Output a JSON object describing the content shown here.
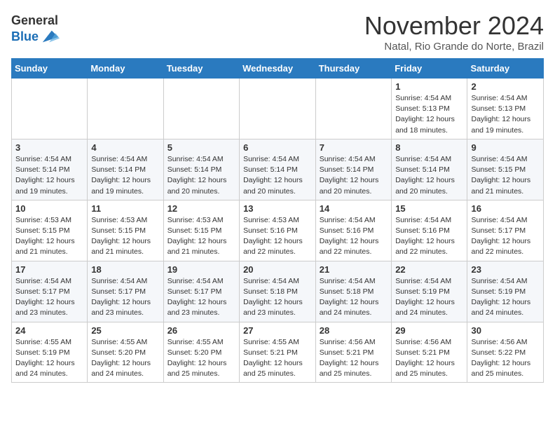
{
  "logo": {
    "general": "General",
    "blue": "Blue"
  },
  "header": {
    "month": "November 2024",
    "location": "Natal, Rio Grande do Norte, Brazil"
  },
  "weekdays": [
    "Sunday",
    "Monday",
    "Tuesday",
    "Wednesday",
    "Thursday",
    "Friday",
    "Saturday"
  ],
  "weeks": [
    [
      {
        "day": "",
        "info": ""
      },
      {
        "day": "",
        "info": ""
      },
      {
        "day": "",
        "info": ""
      },
      {
        "day": "",
        "info": ""
      },
      {
        "day": "",
        "info": ""
      },
      {
        "day": "1",
        "info": "Sunrise: 4:54 AM\nSunset: 5:13 PM\nDaylight: 12 hours\nand 18 minutes."
      },
      {
        "day": "2",
        "info": "Sunrise: 4:54 AM\nSunset: 5:13 PM\nDaylight: 12 hours\nand 19 minutes."
      }
    ],
    [
      {
        "day": "3",
        "info": "Sunrise: 4:54 AM\nSunset: 5:14 PM\nDaylight: 12 hours\nand 19 minutes."
      },
      {
        "day": "4",
        "info": "Sunrise: 4:54 AM\nSunset: 5:14 PM\nDaylight: 12 hours\nand 19 minutes."
      },
      {
        "day": "5",
        "info": "Sunrise: 4:54 AM\nSunset: 5:14 PM\nDaylight: 12 hours\nand 20 minutes."
      },
      {
        "day": "6",
        "info": "Sunrise: 4:54 AM\nSunset: 5:14 PM\nDaylight: 12 hours\nand 20 minutes."
      },
      {
        "day": "7",
        "info": "Sunrise: 4:54 AM\nSunset: 5:14 PM\nDaylight: 12 hours\nand 20 minutes."
      },
      {
        "day": "8",
        "info": "Sunrise: 4:54 AM\nSunset: 5:14 PM\nDaylight: 12 hours\nand 20 minutes."
      },
      {
        "day": "9",
        "info": "Sunrise: 4:54 AM\nSunset: 5:15 PM\nDaylight: 12 hours\nand 21 minutes."
      }
    ],
    [
      {
        "day": "10",
        "info": "Sunrise: 4:53 AM\nSunset: 5:15 PM\nDaylight: 12 hours\nand 21 minutes."
      },
      {
        "day": "11",
        "info": "Sunrise: 4:53 AM\nSunset: 5:15 PM\nDaylight: 12 hours\nand 21 minutes."
      },
      {
        "day": "12",
        "info": "Sunrise: 4:53 AM\nSunset: 5:15 PM\nDaylight: 12 hours\nand 21 minutes."
      },
      {
        "day": "13",
        "info": "Sunrise: 4:53 AM\nSunset: 5:16 PM\nDaylight: 12 hours\nand 22 minutes."
      },
      {
        "day": "14",
        "info": "Sunrise: 4:54 AM\nSunset: 5:16 PM\nDaylight: 12 hours\nand 22 minutes."
      },
      {
        "day": "15",
        "info": "Sunrise: 4:54 AM\nSunset: 5:16 PM\nDaylight: 12 hours\nand 22 minutes."
      },
      {
        "day": "16",
        "info": "Sunrise: 4:54 AM\nSunset: 5:17 PM\nDaylight: 12 hours\nand 22 minutes."
      }
    ],
    [
      {
        "day": "17",
        "info": "Sunrise: 4:54 AM\nSunset: 5:17 PM\nDaylight: 12 hours\nand 23 minutes."
      },
      {
        "day": "18",
        "info": "Sunrise: 4:54 AM\nSunset: 5:17 PM\nDaylight: 12 hours\nand 23 minutes."
      },
      {
        "day": "19",
        "info": "Sunrise: 4:54 AM\nSunset: 5:17 PM\nDaylight: 12 hours\nand 23 minutes."
      },
      {
        "day": "20",
        "info": "Sunrise: 4:54 AM\nSunset: 5:18 PM\nDaylight: 12 hours\nand 23 minutes."
      },
      {
        "day": "21",
        "info": "Sunrise: 4:54 AM\nSunset: 5:18 PM\nDaylight: 12 hours\nand 24 minutes."
      },
      {
        "day": "22",
        "info": "Sunrise: 4:54 AM\nSunset: 5:19 PM\nDaylight: 12 hours\nand 24 minutes."
      },
      {
        "day": "23",
        "info": "Sunrise: 4:54 AM\nSunset: 5:19 PM\nDaylight: 12 hours\nand 24 minutes."
      }
    ],
    [
      {
        "day": "24",
        "info": "Sunrise: 4:55 AM\nSunset: 5:19 PM\nDaylight: 12 hours\nand 24 minutes."
      },
      {
        "day": "25",
        "info": "Sunrise: 4:55 AM\nSunset: 5:20 PM\nDaylight: 12 hours\nand 24 minutes."
      },
      {
        "day": "26",
        "info": "Sunrise: 4:55 AM\nSunset: 5:20 PM\nDaylight: 12 hours\nand 25 minutes."
      },
      {
        "day": "27",
        "info": "Sunrise: 4:55 AM\nSunset: 5:21 PM\nDaylight: 12 hours\nand 25 minutes."
      },
      {
        "day": "28",
        "info": "Sunrise: 4:56 AM\nSunset: 5:21 PM\nDaylight: 12 hours\nand 25 minutes."
      },
      {
        "day": "29",
        "info": "Sunrise: 4:56 AM\nSunset: 5:21 PM\nDaylight: 12 hours\nand 25 minutes."
      },
      {
        "day": "30",
        "info": "Sunrise: 4:56 AM\nSunset: 5:22 PM\nDaylight: 12 hours\nand 25 minutes."
      }
    ]
  ]
}
